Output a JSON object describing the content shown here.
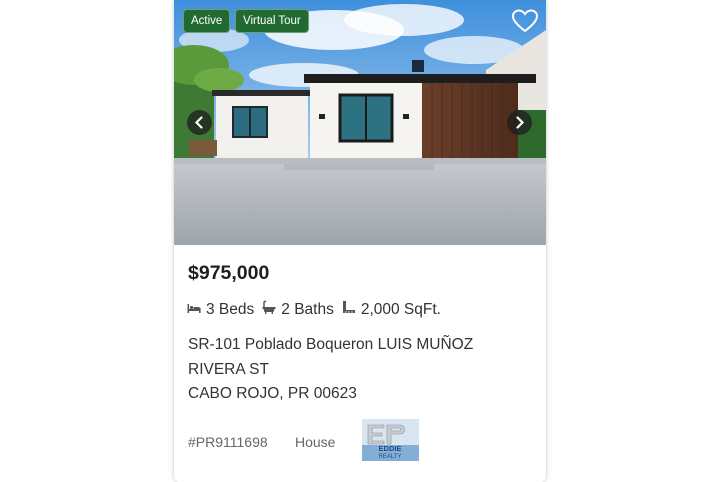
{
  "listing": {
    "badges": {
      "status": "Active",
      "tour": "Virtual Tour"
    },
    "price": "$975,000",
    "beds": "3 Beds",
    "baths": "2 Baths",
    "sqft": "2,000 SqFt.",
    "address_line1": "SR-101 Poblado Boqueron LUIS MUÑOZ RIVERA ST",
    "address_line2": "CABO ROJO, PR 00623",
    "mls_id": "#PR9111698",
    "property_type": "House",
    "broker_logo_text": "EDDIE REALTY"
  },
  "icons": {
    "favorite": "heart-outline-icon",
    "prev": "chevron-left-icon",
    "next": "chevron-right-icon",
    "beds": "bed-icon",
    "baths": "bathtub-icon",
    "sqft": "ruler-icon"
  },
  "colors": {
    "badge_bg": "#216b33",
    "price": "#1f1f1f",
    "meta_text": "#666666"
  }
}
